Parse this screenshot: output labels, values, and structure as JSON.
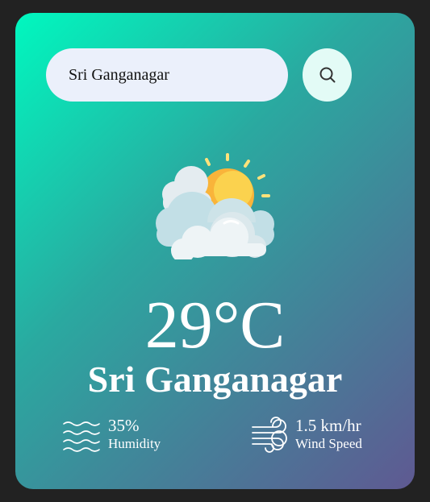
{
  "search": {
    "value": "Sri Ganganagar",
    "button_icon": "search-icon"
  },
  "weather": {
    "icon": "sun-behind-clouds-icon",
    "temperature": "29°C",
    "city": "Sri Ganganagar"
  },
  "details": {
    "humidity": {
      "icon": "humidity-waves-icon",
      "value": "35%",
      "label": "Humidity"
    },
    "wind": {
      "icon": "wind-icon",
      "value": "1.5 km/hr",
      "label": "Wind Speed"
    }
  },
  "colors": {
    "gradient_start": "#00f8bf",
    "gradient_end": "#5f5992",
    "search_bg": "#ebf0fb",
    "sun": "#f9b43a",
    "cloud": "#eef4f6"
  }
}
